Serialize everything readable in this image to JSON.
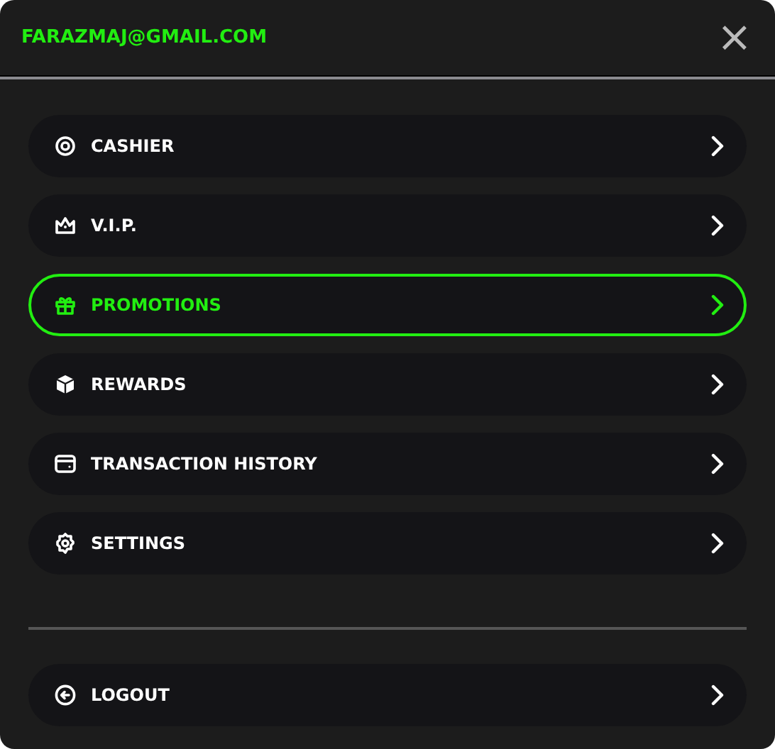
{
  "header": {
    "email": "FARAZMAJ@GMAIL.COM",
    "close": "×"
  },
  "menu": [
    {
      "label": "CASHIER",
      "selected": false
    },
    {
      "label": "V.I.P.",
      "selected": false
    },
    {
      "label": "PROMOTIONS",
      "selected": true
    },
    {
      "label": "REWARDS",
      "selected": false
    },
    {
      "label": "TRANSACTION HISTORY",
      "selected": false
    },
    {
      "label": "SETTINGS",
      "selected": false
    }
  ],
  "footer_menu": [
    {
      "label": "LOGOUT",
      "selected": false
    }
  ]
}
